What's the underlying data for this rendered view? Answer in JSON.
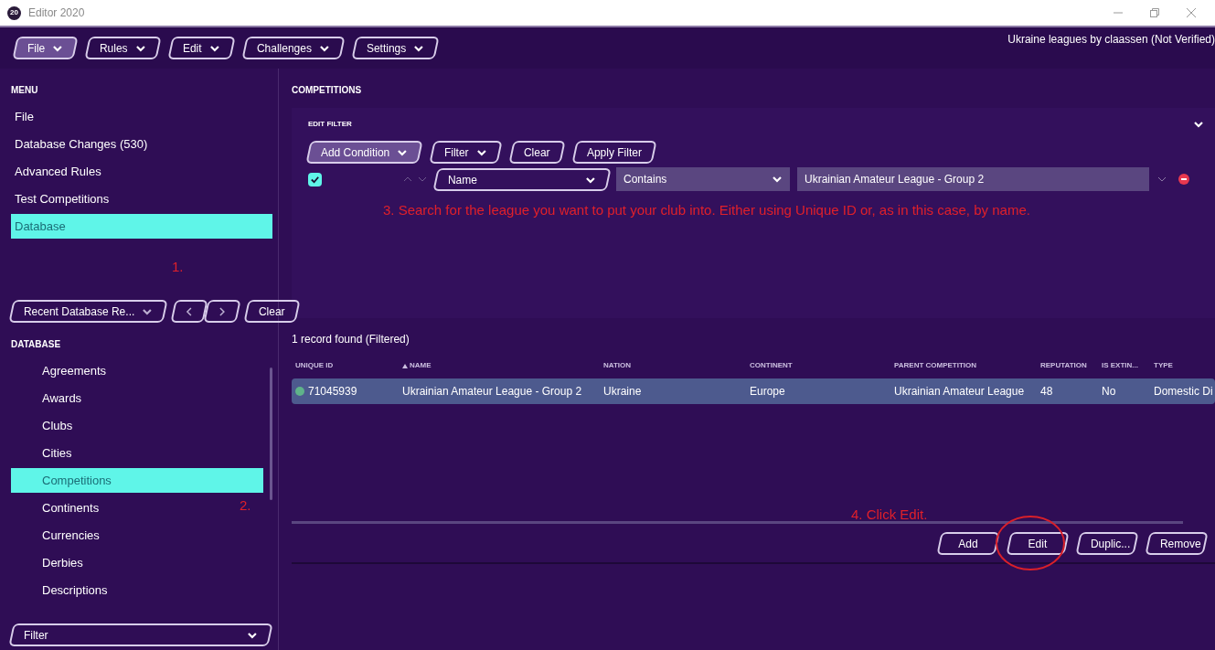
{
  "window": {
    "title": "Editor 2020",
    "app_badge": "20"
  },
  "toolbar": {
    "menus": [
      {
        "label": "File",
        "selected": true
      },
      {
        "label": "Rules",
        "selected": false
      },
      {
        "label": "Edit",
        "selected": false
      },
      {
        "label": "Challenges",
        "selected": false
      },
      {
        "label": "Settings",
        "selected": false
      }
    ],
    "project": "Ukraine leagues by claassen (Not Verified)"
  },
  "menu": {
    "heading": "MENU",
    "items": [
      {
        "label": "File",
        "selected": false
      },
      {
        "label": "Database Changes (530)",
        "selected": false
      },
      {
        "label": "Advanced Rules",
        "selected": false
      },
      {
        "label": "Test Competitions",
        "selected": false
      },
      {
        "label": "Database",
        "selected": true
      }
    ]
  },
  "recent": {
    "dropdown": "Recent Database Re...",
    "clear": "Clear"
  },
  "database": {
    "heading": "DATABASE",
    "items": [
      {
        "label": "Agreements",
        "selected": false
      },
      {
        "label": "Awards",
        "selected": false
      },
      {
        "label": "Clubs",
        "selected": false
      },
      {
        "label": "Cities",
        "selected": false
      },
      {
        "label": "Competitions",
        "selected": true
      },
      {
        "label": "Continents",
        "selected": false
      },
      {
        "label": "Currencies",
        "selected": false
      },
      {
        "label": "Derbies",
        "selected": false
      },
      {
        "label": "Descriptions",
        "selected": false
      }
    ],
    "filter": "Filter"
  },
  "annotations": {
    "step1": "1.",
    "step2": "2.",
    "step3": "3. Search for the league you want to put your club into. Either using Unique ID or, as in this case, by name.",
    "step4": "4. Click Edit."
  },
  "competitions": {
    "heading": "COMPETITIONS",
    "filter": {
      "heading": "EDIT FILTER",
      "buttons": [
        {
          "label": "Add Condition",
          "kind": "dropdown",
          "selected": true
        },
        {
          "label": "Filter",
          "kind": "dropdown",
          "selected": false
        },
        {
          "label": "Clear",
          "kind": "plain",
          "selected": false
        },
        {
          "label": "Apply Filter",
          "kind": "plain",
          "selected": false
        }
      ],
      "condition": {
        "checked": true,
        "field": "Name",
        "operator": "Contains",
        "value": "Ukrainian Amateur League - Group 2"
      }
    },
    "record_count": "1 record found (Filtered)",
    "table": {
      "columns": [
        {
          "label": "UNIQUE ID",
          "sorted": false
        },
        {
          "label": "NAME",
          "sorted": true
        },
        {
          "label": "NATION",
          "sorted": false
        },
        {
          "label": "CONTINENT",
          "sorted": false
        },
        {
          "label": "PARENT COMPETITION",
          "sorted": false
        },
        {
          "label": "REPUTATION",
          "sorted": false
        },
        {
          "label": "IS EXTIN...",
          "sorted": false
        },
        {
          "label": "TYPE",
          "sorted": false
        }
      ],
      "rows": [
        {
          "selected": true,
          "cells": [
            "71045939",
            "Ukrainian Amateur League - Group 2",
            "Ukraine",
            "Europe",
            "Ukrainian Amateur League",
            "48",
            "No",
            "Domestic Di"
          ]
        }
      ]
    },
    "actions": [
      "Add",
      "Edit",
      "Duplic...",
      "Remove"
    ]
  }
}
